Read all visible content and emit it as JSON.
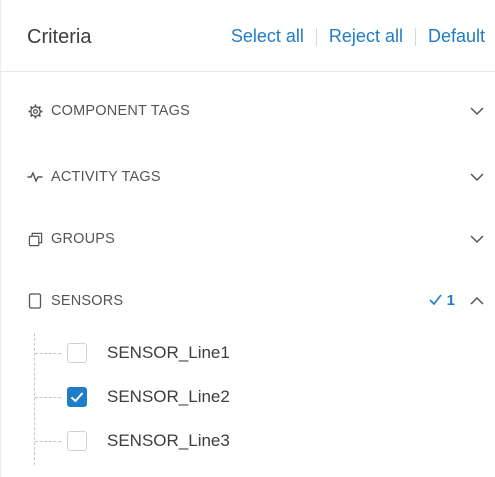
{
  "header": {
    "title": "Criteria",
    "select_all": "Select all",
    "reject_all": "Reject all",
    "default": "Default"
  },
  "sections": [
    {
      "label": "COMPONENT TAGS",
      "icon": "gear-icon",
      "expanded": false
    },
    {
      "label": "ACTIVITY TAGS",
      "icon": "activity-icon",
      "expanded": false
    },
    {
      "label": "GROUPS",
      "icon": "groups-icon",
      "expanded": false
    },
    {
      "label": "SENSORS",
      "icon": "sensor-icon",
      "expanded": true,
      "selected_count": "1"
    }
  ],
  "sensors": {
    "items": [
      {
        "label": "SENSOR_Line1",
        "checked": false
      },
      {
        "label": "SENSOR_Line2",
        "checked": true
      },
      {
        "label": "SENSOR_Line3",
        "checked": false
      }
    ]
  },
  "colors": {
    "accent": "#1f7cc7",
    "text": "#3d3d3d",
    "muted": "#555555"
  }
}
